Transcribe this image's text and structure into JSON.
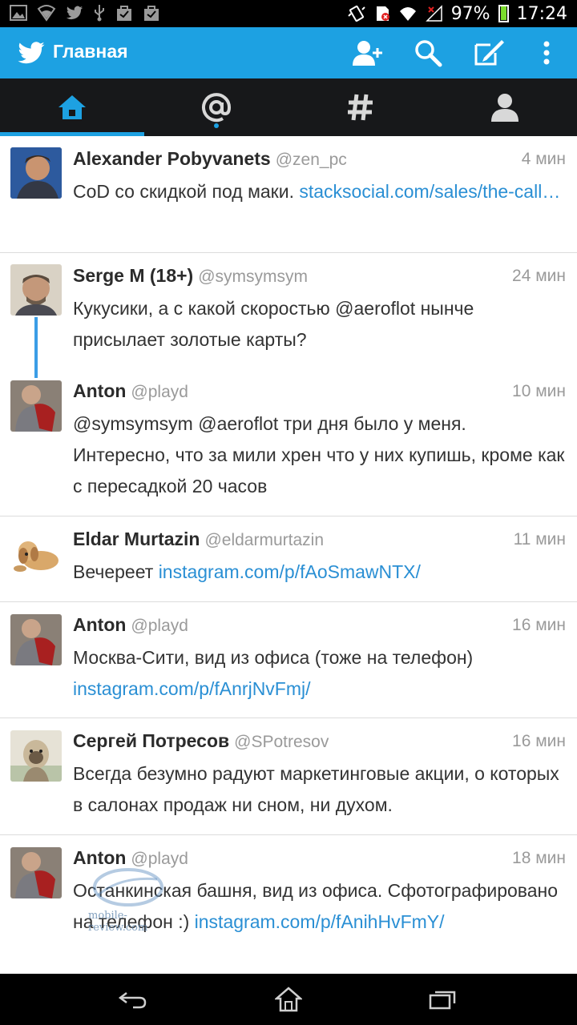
{
  "status_bar": {
    "battery_percent": "97%",
    "time": "17:24",
    "left_icons": [
      "gallery-icon",
      "wifi-icon",
      "twitter-icon",
      "usb-icon",
      "bag-icon",
      "bag-icon"
    ],
    "right_icons": [
      "vibrate-icon",
      "sd-card-icon",
      "wifi-signal-icon",
      "no-signal-icon",
      "battery-icon"
    ]
  },
  "action_bar": {
    "title": "Главная",
    "accent_color": "#1da1e2",
    "actions": [
      "add-user-icon",
      "search-icon",
      "compose-icon",
      "overflow-menu-icon"
    ]
  },
  "tabs": [
    {
      "name": "home-tab",
      "icon": "home-icon",
      "active": true
    },
    {
      "name": "mentions-tab",
      "icon": "at-icon",
      "active": false
    },
    {
      "name": "discover-tab",
      "icon": "hashtag-icon",
      "active": false
    },
    {
      "name": "profile-tab",
      "icon": "person-icon",
      "active": false
    }
  ],
  "tweets": [
    {
      "name": "Alexander Pobyvanets",
      "handle": "@zen_pc",
      "time": "4 мин",
      "text": "CoD со скидкой под маки. ",
      "link": "stacksocial.com/sales/the-call…"
    },
    {
      "name": "Serge M (18+)",
      "handle": "@symsymsym",
      "time": "24 мин",
      "text": "Кукусики, а с какой скоростью @aeroflot нынче присылает золотые карты?",
      "link": ""
    },
    {
      "name": "Anton",
      "handle": "@playd",
      "time": "10 мин",
      "text": "@symsymsym @aeroflot три дня было у меня. Интересно, что за мили хрен что у них купишь, кроме как с пересадкой 20 часов",
      "link": ""
    },
    {
      "name": "Eldar Murtazin",
      "handle": "@eldarmurtazin",
      "time": "11 мин",
      "text": "Вечереет ",
      "link": "instagram.com/p/fAoSmawNTX/"
    },
    {
      "name": "Anton",
      "handle": "@playd",
      "time": "16 мин",
      "text": "Москва-Сити, вид из офиса (тоже на телефон) ",
      "link": "instagram.com/p/fAnrjNvFmj/"
    },
    {
      "name": "Сергей Потресов",
      "handle": "@SPotresov",
      "time": "16 мин",
      "text": "Всегда безумно радуют маркетинговые акции, о которых в салонах продаж ни сном, ни духом.",
      "link": ""
    },
    {
      "name": "Anton",
      "handle": "@playd",
      "time": "18 мин",
      "text": "Останкинская башня, вид из офиса. Сфотографировано на телефон :) ",
      "link": "instagram.com/p/fAnihHvFmY/"
    }
  ],
  "watermark": "mobile-review.com",
  "nav_bar": [
    "back-icon",
    "home-icon",
    "recent-apps-icon"
  ]
}
